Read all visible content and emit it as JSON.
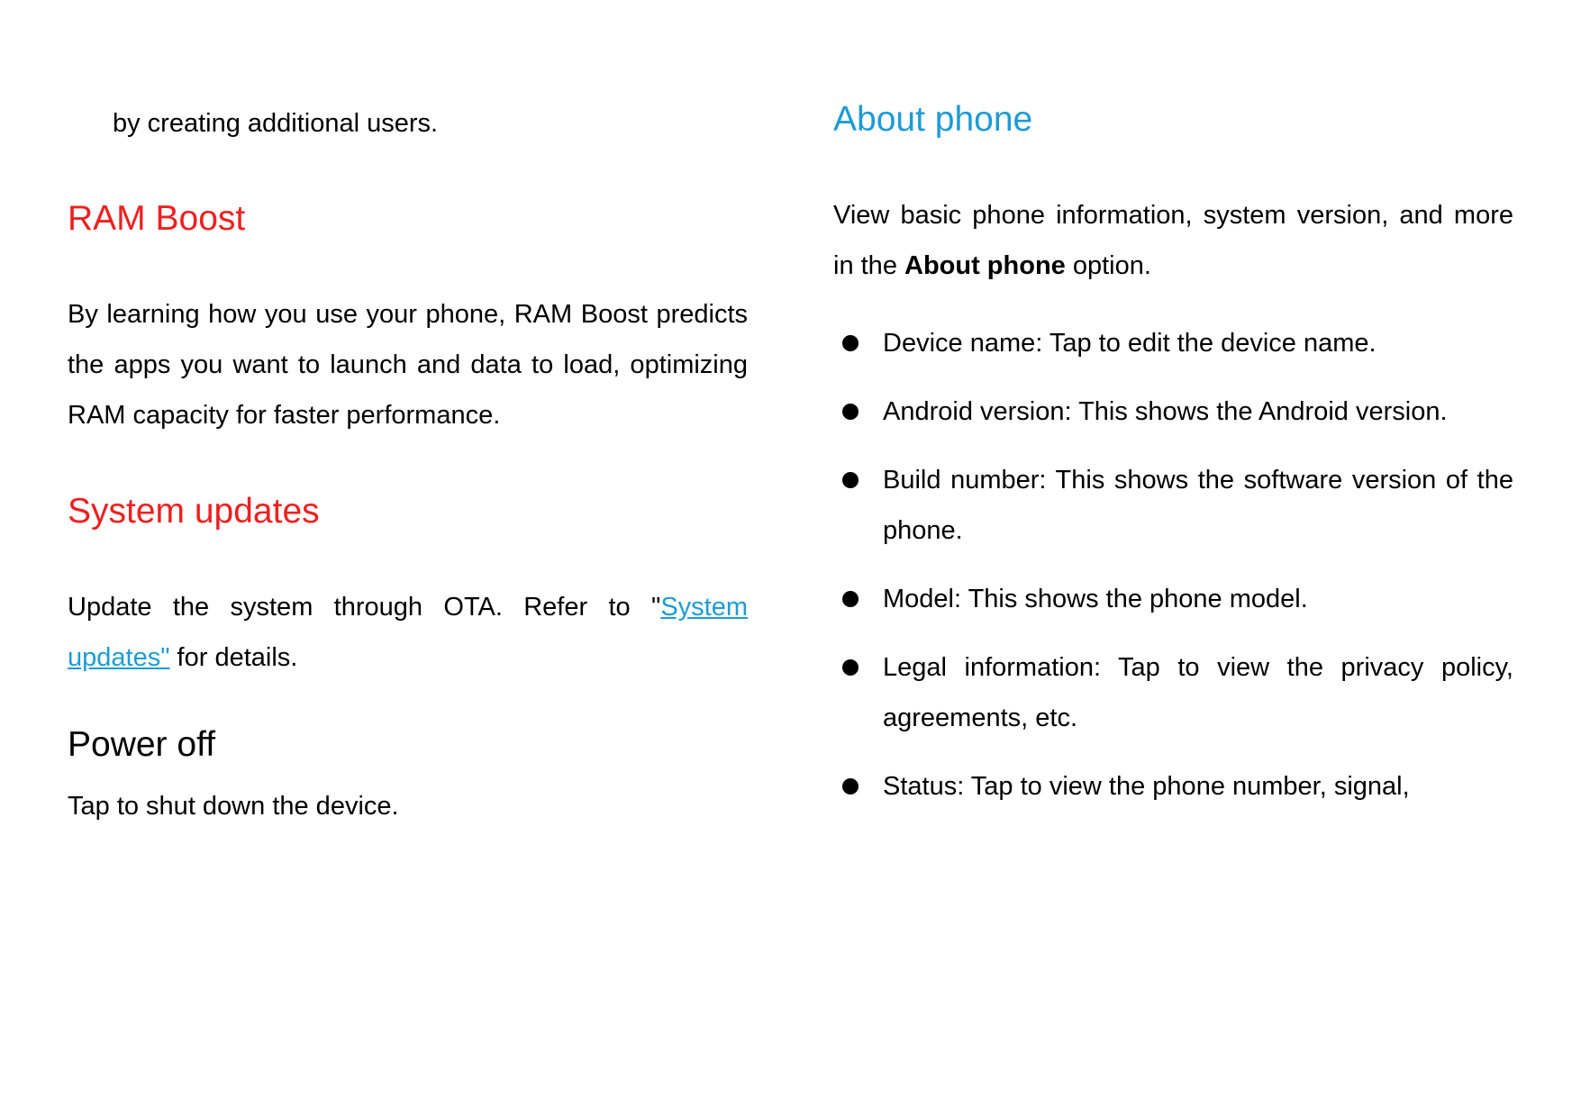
{
  "left": {
    "fragment": "by creating additional users.",
    "ram_boost": {
      "heading": "RAM Boost",
      "body": "By learning how you use your phone, RAM Boost predicts the apps you want to launch and data to load, optimizing RAM capacity for faster performance."
    },
    "system_updates": {
      "heading": "System updates",
      "body_pre": "Update the system through OTA. Refer to \"",
      "link": "System updates\"",
      "body_post": " for details."
    },
    "power_off": {
      "heading": "Power off",
      "body": "Tap to shut down the device."
    }
  },
  "right": {
    "about_phone": {
      "heading": "About phone",
      "intro_pre": "View basic phone information, system version, and more in the ",
      "intro_bold": "About phone",
      "intro_post": " option.",
      "bullets": [
        "Device name: Tap to edit the device name.",
        "Android version: This shows the Android version.",
        "Build number: This shows the software version of the phone.",
        "Model: This shows the phone model.",
        "Legal information: Tap to view the privacy policy, agreements, etc.",
        "Status: Tap to view the phone number, signal,"
      ]
    }
  }
}
